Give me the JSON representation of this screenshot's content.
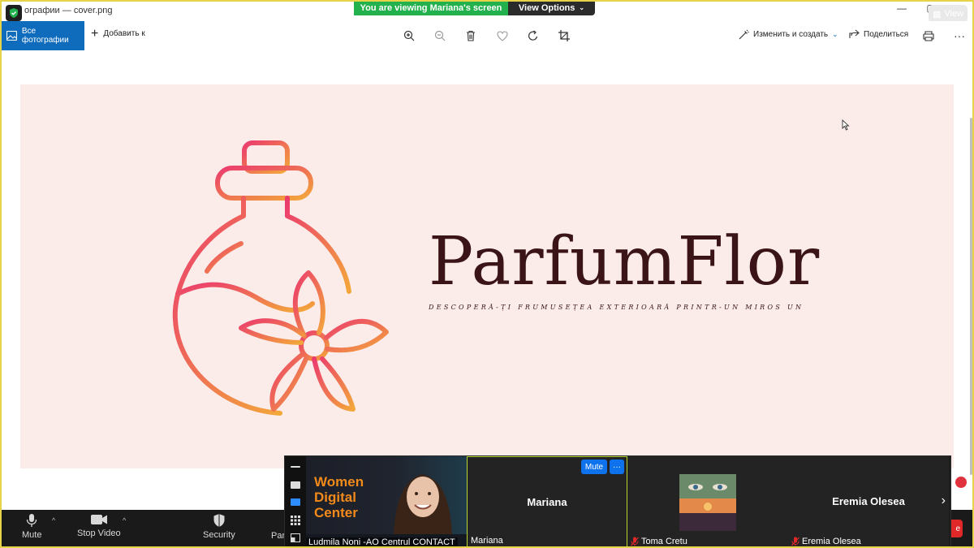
{
  "window": {
    "title": "ографии — cover.png",
    "view_label": "View"
  },
  "banner": {
    "viewing_text": "You are viewing Mariana's screen",
    "view_options_label": "View Options"
  },
  "toolbar": {
    "all_photos_label": "Все фотографии",
    "add_to_label": "Добавить к",
    "edit_create_label": "Изменить и создать",
    "share_label": "Поделиться"
  },
  "image": {
    "brand_name": "ParfumFlor",
    "tagline": "DESCOPERĂ-ȚI FRUMUSEȚEA EXTERIOARĂ PRINTR-UN MIROS UNIC!",
    "colors": {
      "background": "#fbecea",
      "gradient_start": "#eb3b6e",
      "gradient_end": "#f3a73a",
      "text": "#3a1417"
    }
  },
  "zoom_controls": {
    "mute_label": "Mute",
    "stop_video_label": "Stop Video",
    "security_label": "Security",
    "participants_label": "Par"
  },
  "video_strip": {
    "tiles": [
      {
        "name": "Ludmila Noni -AO Centrul CONTACT",
        "banner_text": [
          "Women",
          "Digital",
          "Center"
        ]
      },
      {
        "name": "Mariana",
        "big_name": "Mariana",
        "active": true
      },
      {
        "name": "Toma Cretu",
        "muted": true
      },
      {
        "name": "Eremia Olesea",
        "big_name": "Eremia Olesea",
        "muted": true
      }
    ],
    "hover_mute_label": "Mute",
    "hover_more_label": "···"
  }
}
